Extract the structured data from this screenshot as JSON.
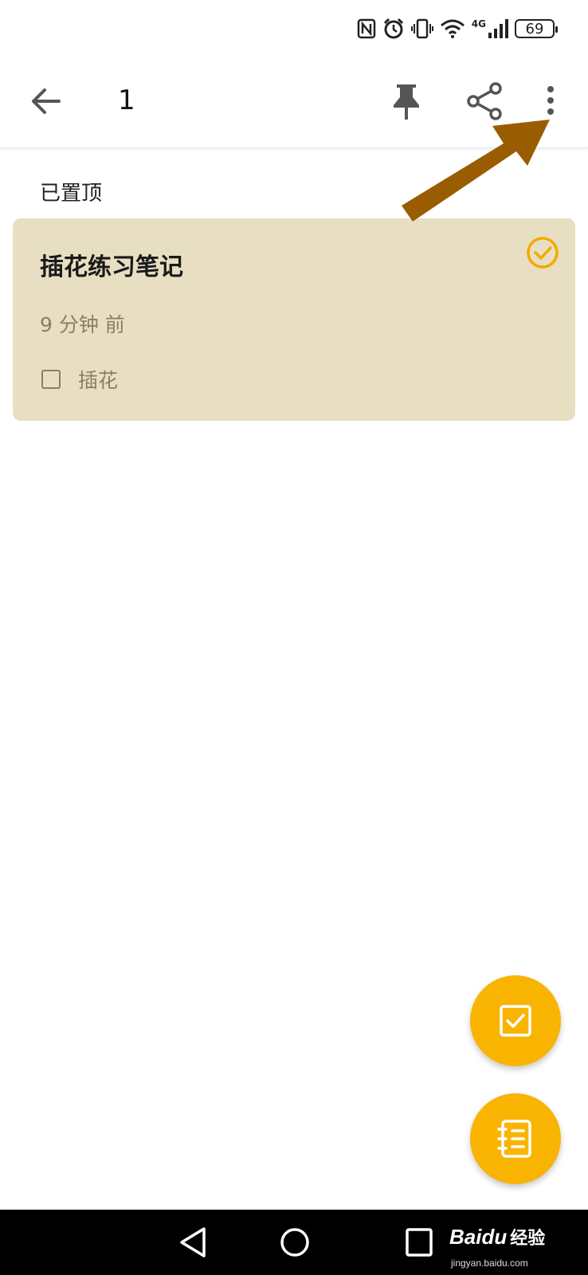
{
  "status_bar": {
    "battery_level": "69",
    "network_label": "4G",
    "icons": [
      "nfc-icon",
      "alarm-icon",
      "vibrate-icon",
      "wifi-icon",
      "signal-icon",
      "battery-icon"
    ]
  },
  "app_bar": {
    "title": "1",
    "icons": [
      "back-arrow-icon",
      "pin-icon",
      "share-icon",
      "more-vert-icon"
    ]
  },
  "section": {
    "label": "已置顶"
  },
  "note": {
    "title": "插花练习笔记",
    "time": "9 分钟 前",
    "checklist": [
      {
        "text": "插花",
        "checked": false
      }
    ],
    "selected": true,
    "background_color": "#e8dfc2"
  },
  "fabs": {
    "todo_icon": "checkbox-icon",
    "note_icon": "notebook-icon",
    "color": "#f8b400"
  },
  "annotation": {
    "arrow_color": "#9a5c00"
  },
  "nav_bar": {
    "icons": [
      "nav-back-icon",
      "nav-home-icon",
      "nav-recent-icon"
    ],
    "watermark_brand": "Baidu",
    "watermark_cn": "经验",
    "watermark_url": "jingyan.baidu.com"
  }
}
